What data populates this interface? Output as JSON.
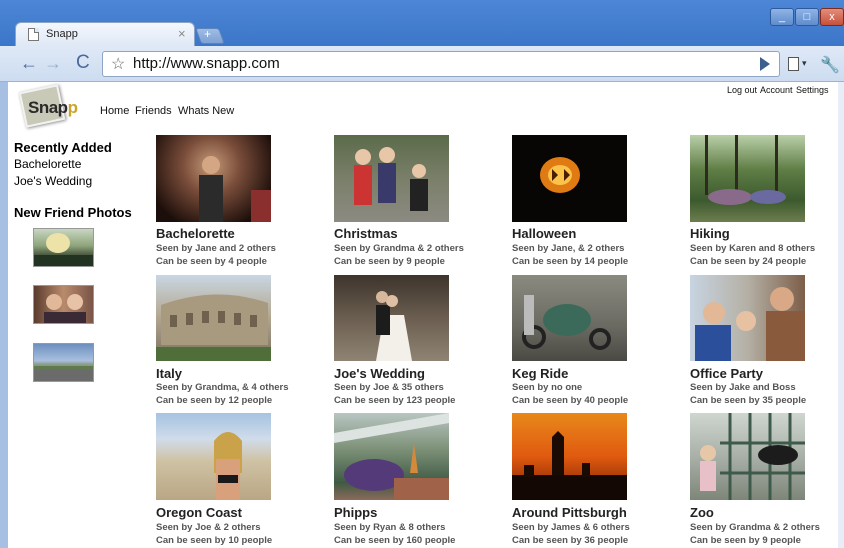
{
  "browser": {
    "tab_title": "Snapp",
    "tab_close": "×",
    "new_tab": "+",
    "window_buttons": {
      "minimize": "_",
      "maximize": "□",
      "close": "x"
    },
    "icons": {
      "back": "arrow-left",
      "forward": "arrow-right",
      "reload": "reload",
      "star": "star",
      "go": "play",
      "page_menu": "page",
      "wrench": "wrench"
    },
    "glyphs": {
      "back": "←",
      "forward": "→",
      "reload": "C",
      "star": "☆",
      "caret": "▾",
      "wrench": "🔧"
    },
    "url": "http://www.snapp.com"
  },
  "site": {
    "logo": "Snapp",
    "logo_main": "Snap",
    "logo_accent": "p",
    "nav": [
      "Home",
      "Friends",
      "Whats New"
    ],
    "user_links": [
      "Log out",
      "Account",
      "Settings"
    ]
  },
  "sidebar": {
    "recent_heading": "Recently Added",
    "recent_items": [
      "Bachelorette",
      "Joe's Wedding"
    ],
    "friend_heading": "New Friend Photos",
    "friend_photos": [
      "friend-photo-1",
      "friend-photo-2",
      "friend-photo-3"
    ]
  },
  "albums": [
    {
      "title": "Bachelorette",
      "seen": "Seen by Jane and 2 others",
      "visibility": "Can be seen by 4 people"
    },
    {
      "title": "Christmas",
      "seen": "Seen by Grandma & 2 others",
      "visibility": "Can be seen by 9 people"
    },
    {
      "title": "Halloween",
      "seen": "Seen by Jane, & 2 others",
      "visibility": "Can be seen by 14 people"
    },
    {
      "title": "Hiking",
      "seen": "Seen by Karen and 8 others",
      "visibility": "Can be seen by 24 people"
    },
    {
      "title": "Italy",
      "seen": "Seen by Grandma, & 4 others",
      "visibility": "Can be seen by 12 people"
    },
    {
      "title": "Joe's Wedding",
      "seen": "Seen by Joe & 35 others",
      "visibility": "Can be seen by 123 people"
    },
    {
      "title": "Keg Ride",
      "seen": "Seen by no one",
      "visibility": "Can be seen by 40 people"
    },
    {
      "title": "Office Party",
      "seen": "Seen by Jake and Boss",
      "visibility": "Can be seen by 35 people"
    },
    {
      "title": "Oregon Coast",
      "seen": "Seen by Joe & 2 others",
      "visibility": "Can be seen by 10 people"
    },
    {
      "title": "Phipps",
      "seen": "Seen by Ryan & 8 others",
      "visibility": "Can be seen by 160 people"
    },
    {
      "title": "Around Pittsburgh",
      "seen": "Seen by James & 6 others",
      "visibility": "Can be seen by 36 people"
    },
    {
      "title": "Zoo",
      "seen": "Seen by Grandma & 2 others",
      "visibility": "Can be seen by 9 people"
    }
  ]
}
